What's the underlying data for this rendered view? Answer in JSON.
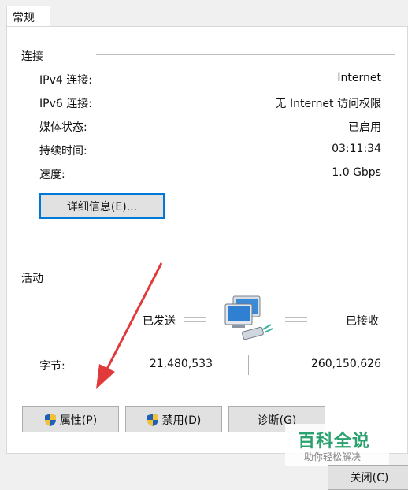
{
  "tab": {
    "label": "常规"
  },
  "connection": {
    "title": "连接",
    "rows": [
      {
        "label": "IPv4 连接:",
        "value": "Internet"
      },
      {
        "label": "IPv6 连接:",
        "value": "无 Internet 访问权限"
      },
      {
        "label": "媒体状态:",
        "value": "已启用"
      },
      {
        "label": "持续时间:",
        "value": "03:11:34"
      },
      {
        "label": "速度:",
        "value": "1.0 Gbps"
      }
    ],
    "details_button": "详细信息(E)..."
  },
  "activity": {
    "title": "活动",
    "sent_label": "已发送",
    "received_label": "已接收",
    "bytes_label": "字节:",
    "bytes_sent": "21,480,533",
    "bytes_received": "260,150,626",
    "network_icon": "network-computers-icon"
  },
  "buttons": {
    "properties": "属性(P)",
    "disable": "禁用(D)",
    "diagnose": "诊断(G)",
    "close": "关闭(C)"
  },
  "watermark": {
    "title": "百科全说",
    "subtitle": "助你轻松解决"
  },
  "colors": {
    "accent": "#0078d7",
    "arrow": "#e03a3a",
    "watermark": "#2aa26d"
  }
}
